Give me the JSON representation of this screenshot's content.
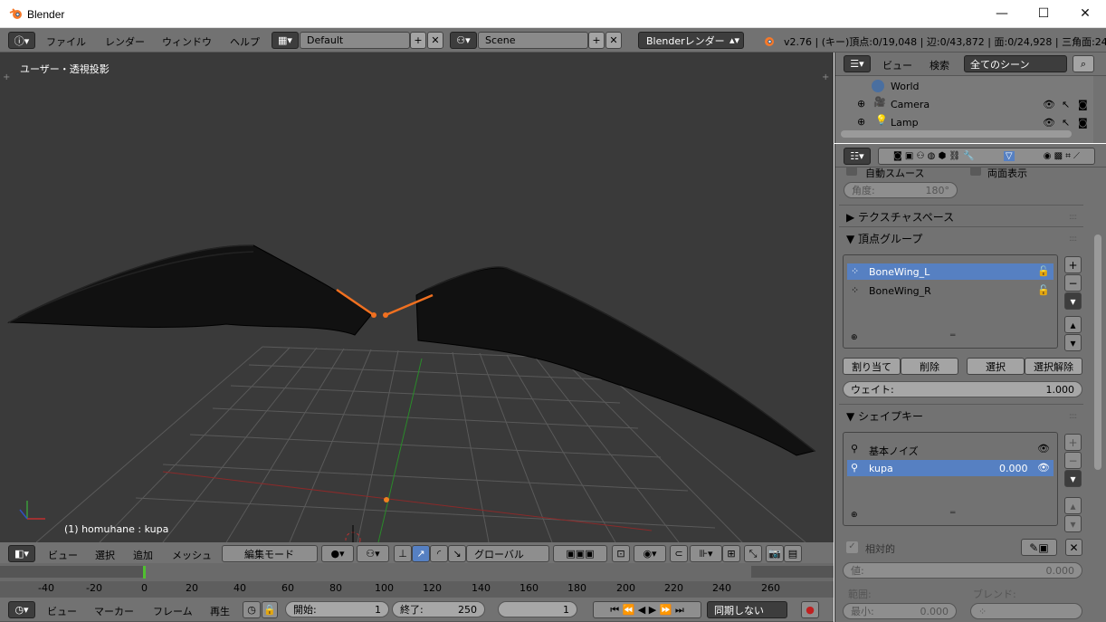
{
  "window": {
    "title": "Blender",
    "min": "—",
    "max": "☐",
    "close": "✕"
  },
  "topbar": {
    "menus": [
      "ファイル",
      "レンダー",
      "ウィンドウ",
      "ヘルプ"
    ],
    "layout": "Default",
    "scene": "Scene",
    "engine": "Blenderレンダー",
    "stats": "v2.76 | (キー)頂点:0/19,048 | 辺:0/43,872 | 面:0/24,928 | 三角面:24,9"
  },
  "viewport": {
    "label": "ユーザー・透視投影",
    "object": "(1) homuhane : kupa"
  },
  "view3d_header": {
    "menus": [
      "ビュー",
      "選択",
      "追加",
      "メッシュ"
    ],
    "mode": "編集モード",
    "orientation": "グローバル"
  },
  "ruler": {
    "ticks": [
      "-40",
      "-20",
      "0",
      "20",
      "40",
      "60",
      "80",
      "100",
      "120",
      "140",
      "160",
      "180",
      "200",
      "220",
      "240",
      "260"
    ]
  },
  "timeline": {
    "menus": [
      "ビュー",
      "マーカー",
      "フレーム",
      "再生"
    ],
    "start_label": "開始:",
    "start": "1",
    "end_label": "終了:",
    "end": "250",
    "current": "1",
    "sync": "同期しない"
  },
  "outliner": {
    "menus": [
      "ビュー",
      "検索"
    ],
    "filter": "全てのシーン",
    "items": [
      "World",
      "Camera",
      "Lamp"
    ]
  },
  "properties": {
    "autosmooth": "自動スムース",
    "double_sided": "両面表示",
    "angle_label": "角度:",
    "angle": "180°",
    "texture_space": "テクスチャスペース",
    "vertex_groups": {
      "title": "頂点グループ",
      "items": [
        "BoneWing_L",
        "BoneWing_R"
      ],
      "assign": "割り当て",
      "remove": "削除",
      "select": "選択",
      "deselect": "選択解除",
      "weight_label": "ウェイト:",
      "weight": "1.000"
    },
    "shape_keys": {
      "title": "シェイプキー",
      "items": [
        {
          "name": "基本ノイズ",
          "value": ""
        },
        {
          "name": "kupa",
          "value": "0.000"
        }
      ],
      "relative": "相対的",
      "value_label": "値:",
      "value": "0.000",
      "range_label": "範囲:",
      "blend_label": "ブレンド:",
      "min_label": "最小:",
      "min": "0.000"
    }
  },
  "colors": {
    "accent": "#5680c2",
    "bg": "#727272",
    "viewport": "#3a3a3a"
  }
}
